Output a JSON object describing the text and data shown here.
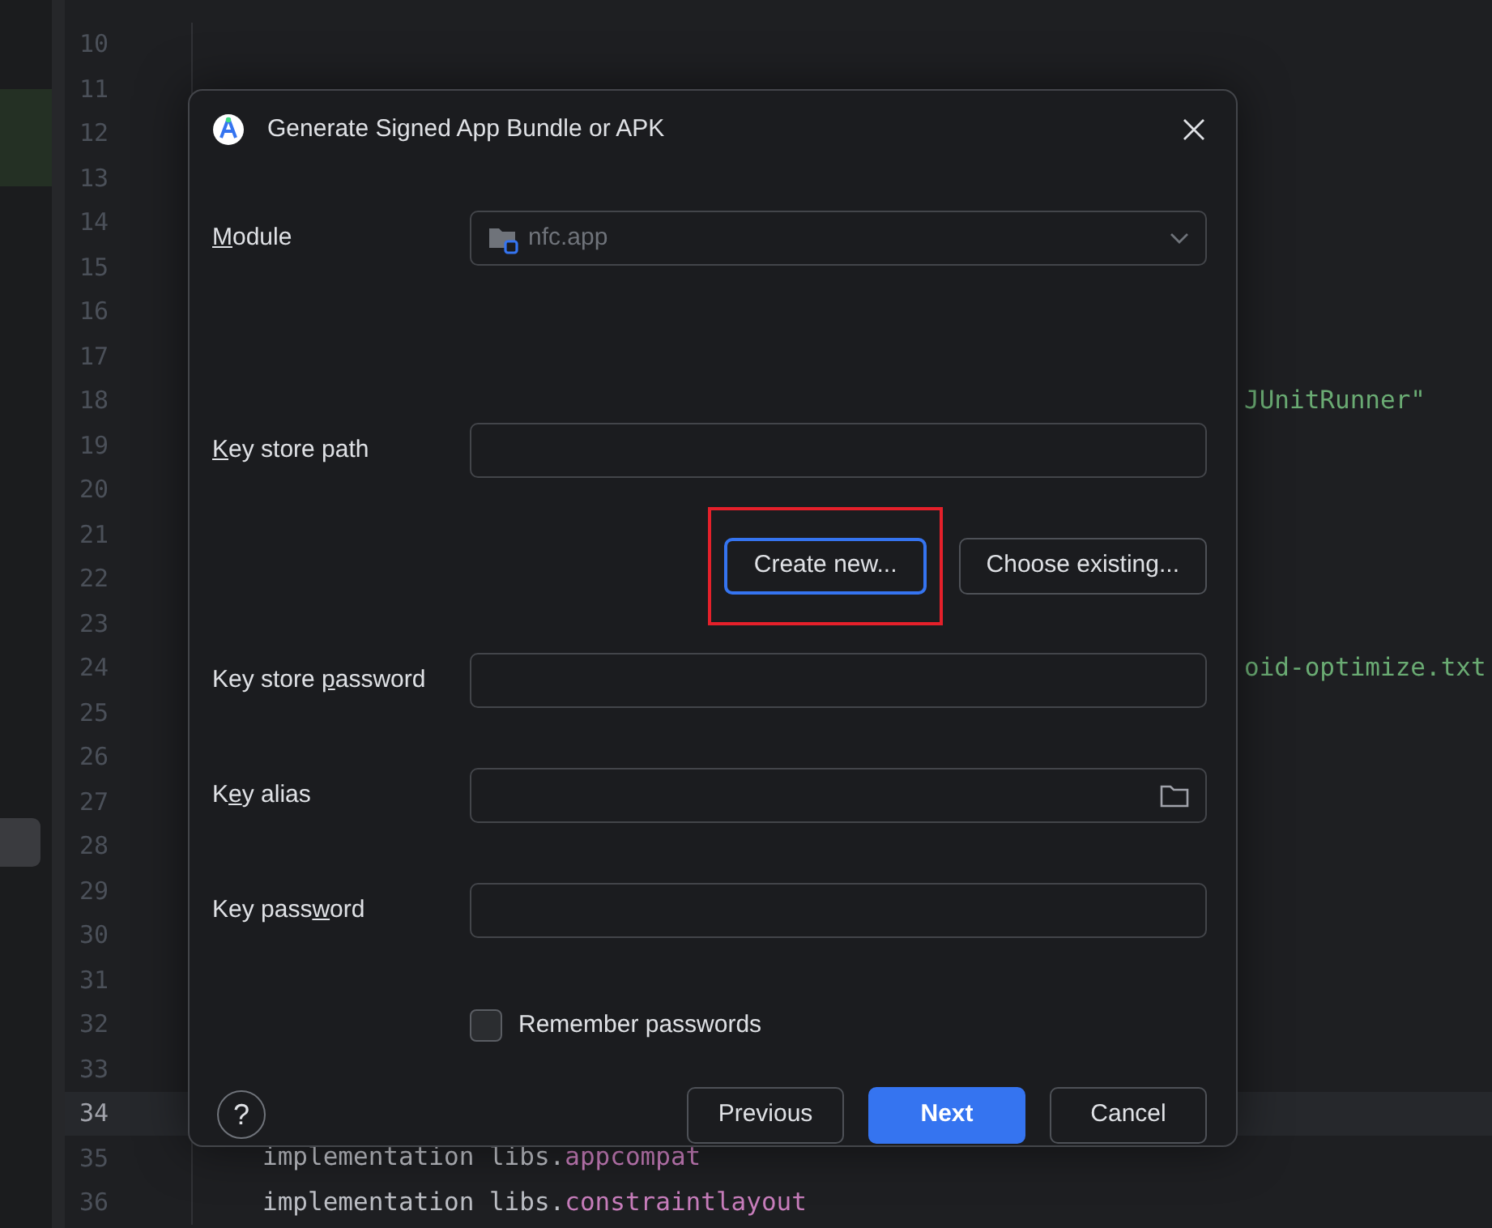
{
  "editor": {
    "lines": [
      {
        "number": "10"
      },
      {
        "number": "11"
      },
      {
        "number": "12"
      },
      {
        "number": "13"
      },
      {
        "number": "14"
      },
      {
        "number": "15"
      },
      {
        "number": "16"
      },
      {
        "number": "17"
      },
      {
        "number": "18",
        "kind": "clipped",
        "segments": [
          {
            "text": "JUnitRunner\"",
            "kind": "string"
          }
        ]
      },
      {
        "number": "19"
      },
      {
        "number": "20"
      },
      {
        "number": "21"
      },
      {
        "number": "22"
      },
      {
        "number": "23"
      },
      {
        "number": "24",
        "kind": "clipped",
        "segments": [
          {
            "text": "oid-optimize.txt",
            "kind": "string"
          }
        ]
      },
      {
        "number": "25"
      },
      {
        "number": "26"
      },
      {
        "number": "27"
      },
      {
        "number": "28"
      },
      {
        "number": "29"
      },
      {
        "number": "30"
      },
      {
        "number": "31"
      },
      {
        "number": "32"
      },
      {
        "number": "33"
      },
      {
        "number": "34",
        "current": true
      },
      {
        "number": "35",
        "kind": "full",
        "segments": [
          {
            "text": "implementation libs.",
            "kind": "plain"
          },
          {
            "text": "appcompat",
            "kind": "property"
          }
        ]
      },
      {
        "number": "36",
        "kind": "full",
        "segments": [
          {
            "text": "implementation libs.",
            "kind": "plain"
          },
          {
            "text": "constraintlayout",
            "kind": "property"
          }
        ]
      }
    ]
  },
  "dialog": {
    "title": "Generate Signed App Bundle or APK",
    "fields": [
      {
        "label_parts": {
          "key": "M",
          "after": "odule"
        },
        "kind": "combo",
        "value": "nfc.app",
        "disabled": true
      },
      {
        "label_parts": {
          "key": "K",
          "after": "ey store path"
        },
        "kind": "text"
      },
      {
        "kind": "buttons",
        "buttons": [
          {
            "label": "Create new...",
            "focused": true,
            "annotated": true
          },
          {
            "label": "Choose existing...",
            "focused": false,
            "annotated": false
          }
        ]
      },
      {
        "label_parts": {
          "before": "Key store ",
          "key": "p",
          "after": "assword"
        },
        "kind": "text"
      },
      {
        "label_parts": {
          "before": "K",
          "key": "e",
          "after": "y alias"
        },
        "kind": "browse"
      },
      {
        "label_parts": {
          "before": "Key pass",
          "key": "w",
          "after": "ord"
        },
        "kind": "text"
      },
      {
        "kind": "checkbox",
        "label": "Remember passwords",
        "checked": false
      }
    ],
    "footer": {
      "help": "?",
      "buttons": [
        {
          "label": "Previous",
          "primary": false
        },
        {
          "label": "Next",
          "primary": true
        },
        {
          "label": "Cancel",
          "primary": false
        }
      ]
    }
  }
}
